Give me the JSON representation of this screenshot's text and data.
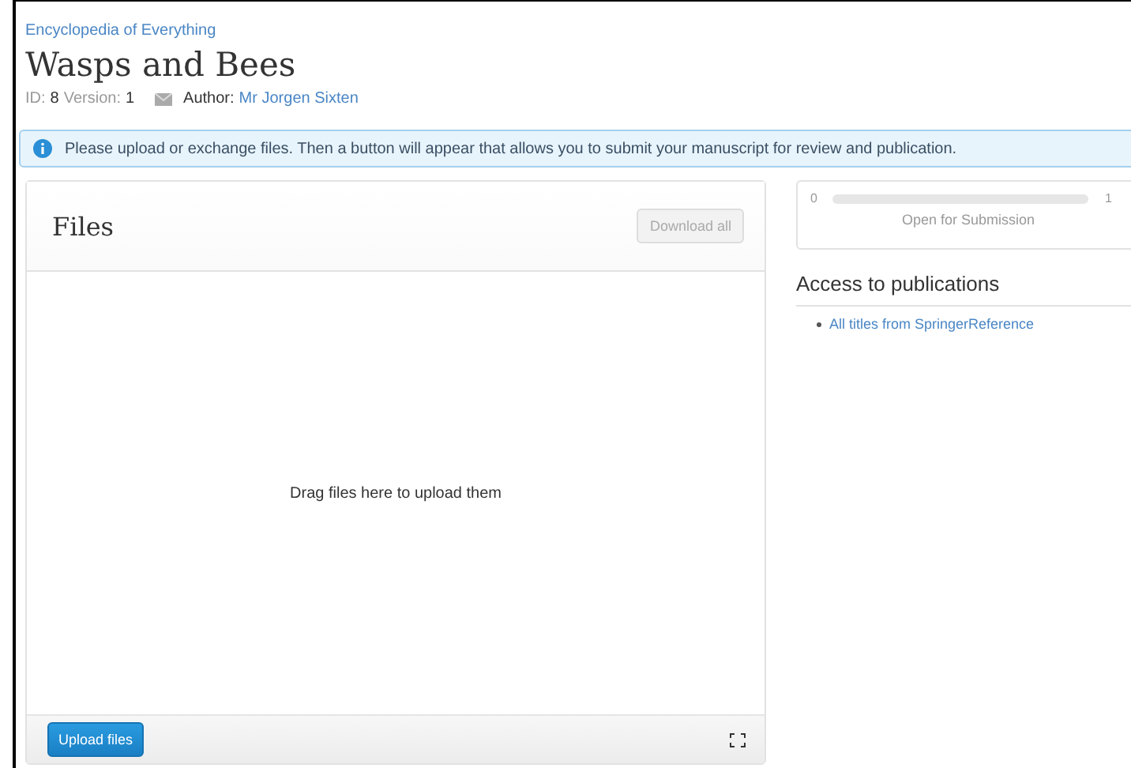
{
  "breadcrumb": "Encyclopedia of Everything",
  "title": "Wasps and Bees",
  "meta": {
    "id_label": "ID:",
    "id": "8",
    "version_label": "Version:",
    "version": "1",
    "author_label": "Author:",
    "author": "Mr Jorgen Sixten"
  },
  "alert": "Please upload or exchange files. Then a button will appear that allows you to submit your manuscript for review and publication.",
  "files_panel": {
    "title": "Files",
    "download_button": {
      "label": "Download all",
      "disabled": true
    },
    "dropzone": "Drag files here to upload them",
    "upload_button": "Upload files"
  },
  "progress": {
    "min": "0",
    "max": "1",
    "level": 0,
    "status": "Open for Submission"
  },
  "access": {
    "title": "Access to publications",
    "links": [
      "All titles from SpringerReference"
    ]
  }
}
